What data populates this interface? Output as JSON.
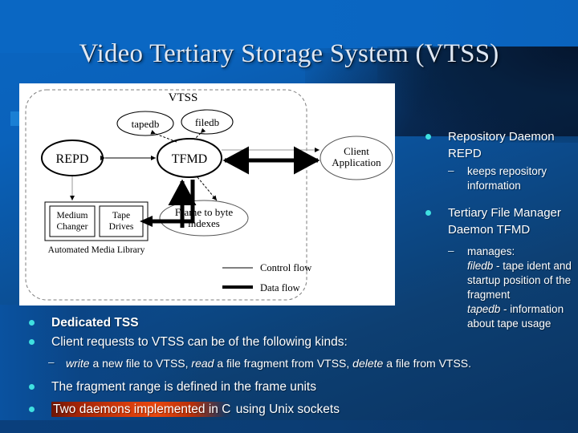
{
  "slide": {
    "title": "Video Tertiary Storage System (VTSS)"
  },
  "diagram": {
    "alt_name": "vtss-architecture-diagram",
    "boundary_label": "VTSS",
    "nodes": {
      "tapedb": "tapedb",
      "filedb": "filedb",
      "repd": "REPD",
      "tfmd": "TFMD",
      "client": "Client\nApplication",
      "client_line1": "Client",
      "client_line2": "Application",
      "frame_idx_line1": "Frame to byte",
      "frame_idx_line2": "indexes",
      "medium_changer_line1": "Medium",
      "medium_changer_line2": "Changer",
      "tape_drives_line1": "Tape",
      "tape_drives_line2": "Drives",
      "aml": "Automated Media Library"
    },
    "legend": {
      "control_flow": "Control flow",
      "data_flow": "Data flow"
    }
  },
  "right_column": [
    {
      "level": 1,
      "text": "Repository Daemon REPD"
    },
    {
      "level": 2,
      "text": "keeps repository information"
    },
    {
      "level": 1,
      "text": "Tertiary File Manager Daemon TFMD"
    },
    {
      "level": 2,
      "text": "manages:",
      "sub_italic_1": "filedb",
      "sub_rest_1": " - tape ident and startup position of the fragment",
      "sub_italic_2": "tapedb",
      "sub_rest_2": " - information about tape usage"
    }
  ],
  "right_column_flat": {
    "item1": "Repository Daemon REPD",
    "item1_sub": "keeps repository information",
    "item2": "Tertiary File Manager Daemon TFMD",
    "item2_sub_lead": "manages:",
    "item2_sub_i1": "filedb",
    "item2_sub_t1": " - tape ident and startup position of the fragment",
    "item2_sub_i2": "tapedb",
    "item2_sub_t2": " - information about tape usage"
  },
  "bottom_column": {
    "item1": "Dedicated TSS",
    "item2": "Client requests to VTSS can be of the following kinds:",
    "item2_sub_i1": "write",
    "item2_sub_t1": " a new file to VTSS, ",
    "item2_sub_i2": "read",
    "item2_sub_t2": " a file fragment from VTSS, ",
    "item2_sub_i3": "delete",
    "item2_sub_t3": " a file from VTSS.",
    "item3": "The fragment range is defined in the frame units",
    "item4_highlight": "Two daemons implemented in C",
    "item4_rest": " using Unix sockets"
  },
  "colors": {
    "bullet_marker": "#3fe0e0",
    "text": "#ffffff",
    "title_text": "#dfe8f4",
    "background_light_blue": "#0a67c3",
    "background_dark_navy": "#061a36",
    "highlight_red": "#d63c0c",
    "accent_square": "#1a7fd4"
  }
}
